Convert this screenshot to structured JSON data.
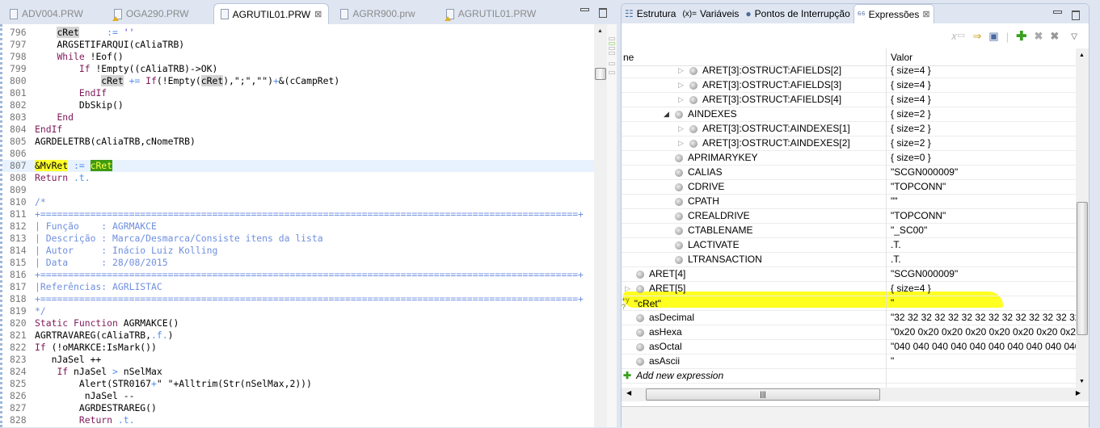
{
  "editor_tabs": [
    {
      "label": "ADV004.PRW",
      "warn": false,
      "active": false
    },
    {
      "label": "OGA290.PRW",
      "warn": true,
      "active": false
    },
    {
      "label": "AGRUTIL01.PRW",
      "warn": false,
      "active": true
    },
    {
      "label": "AGRR900.prw",
      "warn": false,
      "active": false
    },
    {
      "label": "AGRUTIL01.PRW",
      "warn": true,
      "active": false
    }
  ],
  "current_line": "807",
  "code": [
    {
      "n": "796",
      "t": [
        [
          "",
          "    "
        ],
        [
          "hl",
          "cRet"
        ],
        [
          "",
          "     "
        ],
        [
          "op",
          ":="
        ],
        [
          "st",
          " ''"
        ]
      ]
    },
    {
      "n": "797",
      "t": [
        [
          "",
          "    ARGSETIFARQUI(cAliaTRB)"
        ]
      ]
    },
    {
      "n": "798",
      "t": [
        [
          "",
          "    "
        ],
        [
          "kw",
          "While"
        ],
        [
          "",
          " !Eof()"
        ]
      ]
    },
    {
      "n": "799",
      "t": [
        [
          "",
          "        "
        ],
        [
          "kw",
          "If"
        ],
        [
          "",
          " !Empty((cAliaTRB)->OK)"
        ]
      ]
    },
    {
      "n": "800",
      "t": [
        [
          "",
          "            "
        ],
        [
          "hl",
          "cRet"
        ],
        [
          "op",
          " +="
        ],
        [
          "",
          " "
        ],
        [
          "kw",
          "If"
        ],
        [
          "",
          "(!Empty("
        ],
        [
          "hl",
          "cRet"
        ],
        [
          "",
          "),\";\",\"\")"
        ],
        [
          "op",
          "+"
        ],
        [
          "",
          "&(cCampRet)"
        ]
      ]
    },
    {
      "n": "801",
      "t": [
        [
          "",
          "        "
        ],
        [
          "kw",
          "EndIf"
        ]
      ]
    },
    {
      "n": "802",
      "t": [
        [
          "",
          "        DbSkip()"
        ]
      ]
    },
    {
      "n": "803",
      "t": [
        [
          "",
          "    "
        ],
        [
          "kw",
          "End"
        ]
      ]
    },
    {
      "n": "804",
      "t": [
        [
          "kw",
          "EndIf"
        ]
      ]
    },
    {
      "n": "805",
      "t": [
        [
          "",
          "AGRDELETRB(cAliaTRB,cNomeTRB)"
        ]
      ]
    },
    {
      "n": "806",
      "t": []
    },
    {
      "n": "807",
      "t": [
        [
          "yel",
          "&MvRet"
        ],
        [
          "op",
          " := "
        ],
        [
          "yel2",
          "cRet"
        ]
      ]
    },
    {
      "n": "808",
      "t": [
        [
          "kw",
          "Return"
        ],
        [
          "op",
          " .t."
        ]
      ]
    },
    {
      "n": "809",
      "t": []
    },
    {
      "n": "810",
      "t": [
        [
          "cm",
          "/*"
        ]
      ]
    },
    {
      "n": "811",
      "t": [
        [
          "cm",
          "+=================================================================================================+"
        ]
      ]
    },
    {
      "n": "812",
      "t": [
        [
          "cm",
          "| Função    : AGRMAKCE"
        ]
      ]
    },
    {
      "n": "813",
      "t": [
        [
          "cm",
          "| Descrição : Marca/Desmarca/Consiste itens da lista"
        ]
      ]
    },
    {
      "n": "814",
      "t": [
        [
          "cm",
          "| Autor     : Inácio Luiz Kolling"
        ]
      ]
    },
    {
      "n": "815",
      "t": [
        [
          "cm",
          "| Data      : 28/08/2015"
        ]
      ]
    },
    {
      "n": "816",
      "t": [
        [
          "cm",
          "+=================================================================================================+"
        ]
      ]
    },
    {
      "n": "817",
      "t": [
        [
          "cm",
          "|Referências: AGRLISTAC"
        ]
      ]
    },
    {
      "n": "818",
      "t": [
        [
          "cm",
          "+=================================================================================================+"
        ]
      ]
    },
    {
      "n": "819",
      "t": [
        [
          "cm",
          "*/"
        ]
      ]
    },
    {
      "n": "820",
      "t": [
        [
          "kw",
          "Static Function"
        ],
        [
          "",
          " AGRMAKCE()"
        ]
      ]
    },
    {
      "n": "821",
      "t": [
        [
          "",
          "AGRTRAVAREG(cAliaTRB,"
        ],
        [
          "op",
          ".f."
        ],
        [
          "",
          ")"
        ]
      ]
    },
    {
      "n": "822",
      "t": [
        [
          "kw",
          "If"
        ],
        [
          "",
          " (!oMARKCE:IsMark())"
        ]
      ]
    },
    {
      "n": "823",
      "t": [
        [
          "",
          "   nJaSel ++"
        ]
      ]
    },
    {
      "n": "824",
      "t": [
        [
          "",
          "    "
        ],
        [
          "kw",
          "If"
        ],
        [
          "",
          " nJaSel "
        ],
        [
          "op",
          ">"
        ],
        [
          "",
          " nSelMax"
        ]
      ]
    },
    {
      "n": "825",
      "t": [
        [
          "",
          "        Alert(STR0167"
        ],
        [
          "op",
          "+"
        ],
        [
          "",
          "\" \"+Alltrim(Str(nSelMax,2)))"
        ]
      ]
    },
    {
      "n": "826",
      "t": [
        [
          "",
          "         nJaSel --"
        ]
      ]
    },
    {
      "n": "827",
      "t": [
        [
          "",
          "        AGRDESTRAREG()"
        ]
      ]
    },
    {
      "n": "828",
      "t": [
        [
          "",
          "        "
        ],
        [
          "kw",
          "Return"
        ],
        [
          "op",
          " .t."
        ]
      ]
    }
  ],
  "right_tabs": [
    {
      "label": "Estrutura",
      "icon": "outline-icon",
      "active": false
    },
    {
      "label": "Variáveis",
      "icon": "variables-icon",
      "prefix": "(x)=",
      "active": false
    },
    {
      "label": "Pontos de Interrupção",
      "icon": "breakpoints-icon",
      "active": false
    },
    {
      "label": "Expressões",
      "icon": "expressions-icon",
      "active": true
    }
  ],
  "columns": {
    "name": "ne",
    "value": "Valor"
  },
  "rows": [
    {
      "name": "ARET[3]:OSTRUCT:AFIELDS[2]",
      "value": "{ size=4 }",
      "level": 3,
      "expander": "collapsed"
    },
    {
      "name": "ARET[3]:OSTRUCT:AFIELDS[3]",
      "value": "{ size=4 }",
      "level": 3,
      "expander": "collapsed"
    },
    {
      "name": "ARET[3]:OSTRUCT:AFIELDS[4]",
      "value": "{ size=4 }",
      "level": 3,
      "expander": "collapsed"
    },
    {
      "name": "AINDEXES",
      "value": "{ size=2 }",
      "level": 2,
      "expander": "expanded"
    },
    {
      "name": "ARET[3]:OSTRUCT:AINDEXES[1]",
      "value": "{ size=2 }",
      "level": 3,
      "expander": "collapsed"
    },
    {
      "name": "ARET[3]:OSTRUCT:AINDEXES[2]",
      "value": "{ size=2 }",
      "level": 3,
      "expander": "collapsed"
    },
    {
      "name": "APRIMARYKEY",
      "value": "{ size=0 }",
      "level": 2,
      "expander": "none"
    },
    {
      "name": "CALIAS",
      "value": "\"SCGN000009\"",
      "level": 2,
      "expander": "none"
    },
    {
      "name": "CDRIVE",
      "value": "\"TOPCONN\"",
      "level": 2,
      "expander": "none"
    },
    {
      "name": "CPATH",
      "value": "\"\"",
      "level": 2,
      "expander": "none"
    },
    {
      "name": "CREALDRIVE",
      "value": "\"TOPCONN\"",
      "level": 2,
      "expander": "none"
    },
    {
      "name": "CTABLENAME",
      "value": "\"_SC00\"",
      "level": 2,
      "expander": "none"
    },
    {
      "name": "LACTIVATE",
      "value": ".T.",
      "level": 2,
      "expander": "none"
    },
    {
      "name": "LTRANSACTION",
      "value": ".T.",
      "level": 2,
      "expander": "none"
    },
    {
      "name": "ARET[4]",
      "value": "\"SCGN000009\"",
      "level": 0,
      "expander": "none"
    },
    {
      "name": "ARET[5]",
      "value": "{ size=4 }",
      "level": 0,
      "expander": "collapsed"
    },
    {
      "name": "\"cRet\"",
      "value": "\"",
      "level": -1,
      "expander": "expression"
    },
    {
      "name": "asDecimal",
      "value": "\"32 32 32 32 32 32 32 32 32 32 32 32 32 32 32 32",
      "level": 0,
      "expander": "none"
    },
    {
      "name": "asHexa",
      "value": "\"0x20 0x20 0x20 0x20 0x20 0x20 0x20 0x20 0x20 0x20",
      "level": 0,
      "expander": "none"
    },
    {
      "name": "asOctal",
      "value": "\"040 040 040 040 040 040 040 040 040 040 040 040",
      "level": 0,
      "expander": "none"
    },
    {
      "name": "asAscii",
      "value": "\"",
      "level": 0,
      "expander": "none"
    }
  ],
  "add_expression_label": "Add new expression",
  "highlight_color": "#ffff20"
}
